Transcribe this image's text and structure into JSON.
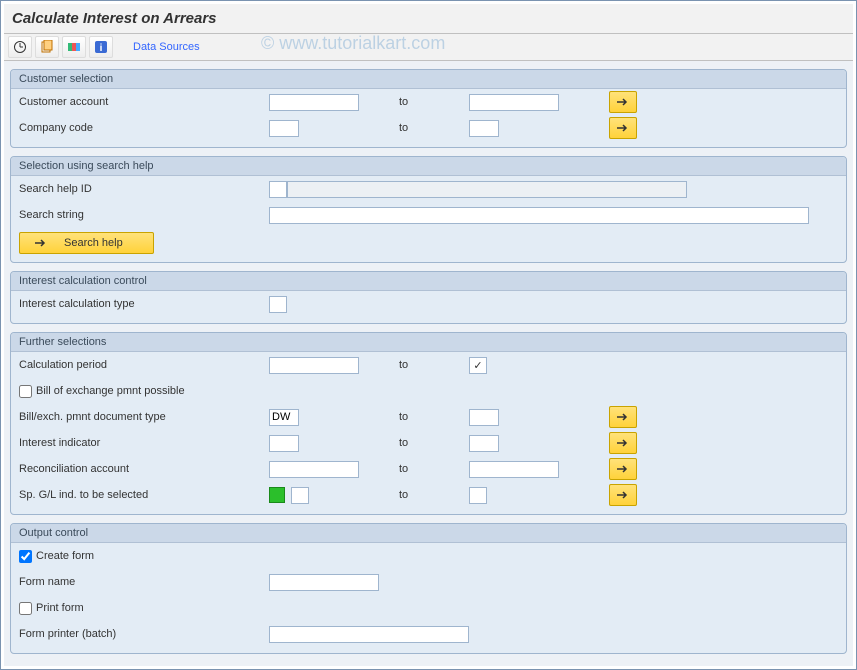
{
  "title": "Calculate Interest on Arrears",
  "toolbar": {
    "data_sources": "Data Sources"
  },
  "watermark": "©  www.tutorialkart.com",
  "groups": {
    "customer": {
      "title": "Customer selection",
      "customer_account": "Customer account",
      "company_code": "Company code",
      "to": "to"
    },
    "search": {
      "title": "Selection using search help",
      "help_id": "Search help ID",
      "search_string": "Search string",
      "button": "Search help"
    },
    "interest": {
      "title": "Interest calculation control",
      "calc_type": "Interest calculation type"
    },
    "further": {
      "title": "Further selections",
      "calc_period": "Calculation period",
      "boe": "Bill of exchange pmnt possible",
      "doc_type": "Bill/exch. pmnt document type",
      "doc_type_val": "DW",
      "int_ind": "Interest indicator",
      "recon": "Reconciliation account",
      "spgl": "Sp. G/L ind. to be selected",
      "to": "to"
    },
    "output": {
      "title": "Output control",
      "create": "Create form",
      "form_name": "Form name",
      "print": "Print form",
      "printer": "Form printer (batch)"
    }
  }
}
